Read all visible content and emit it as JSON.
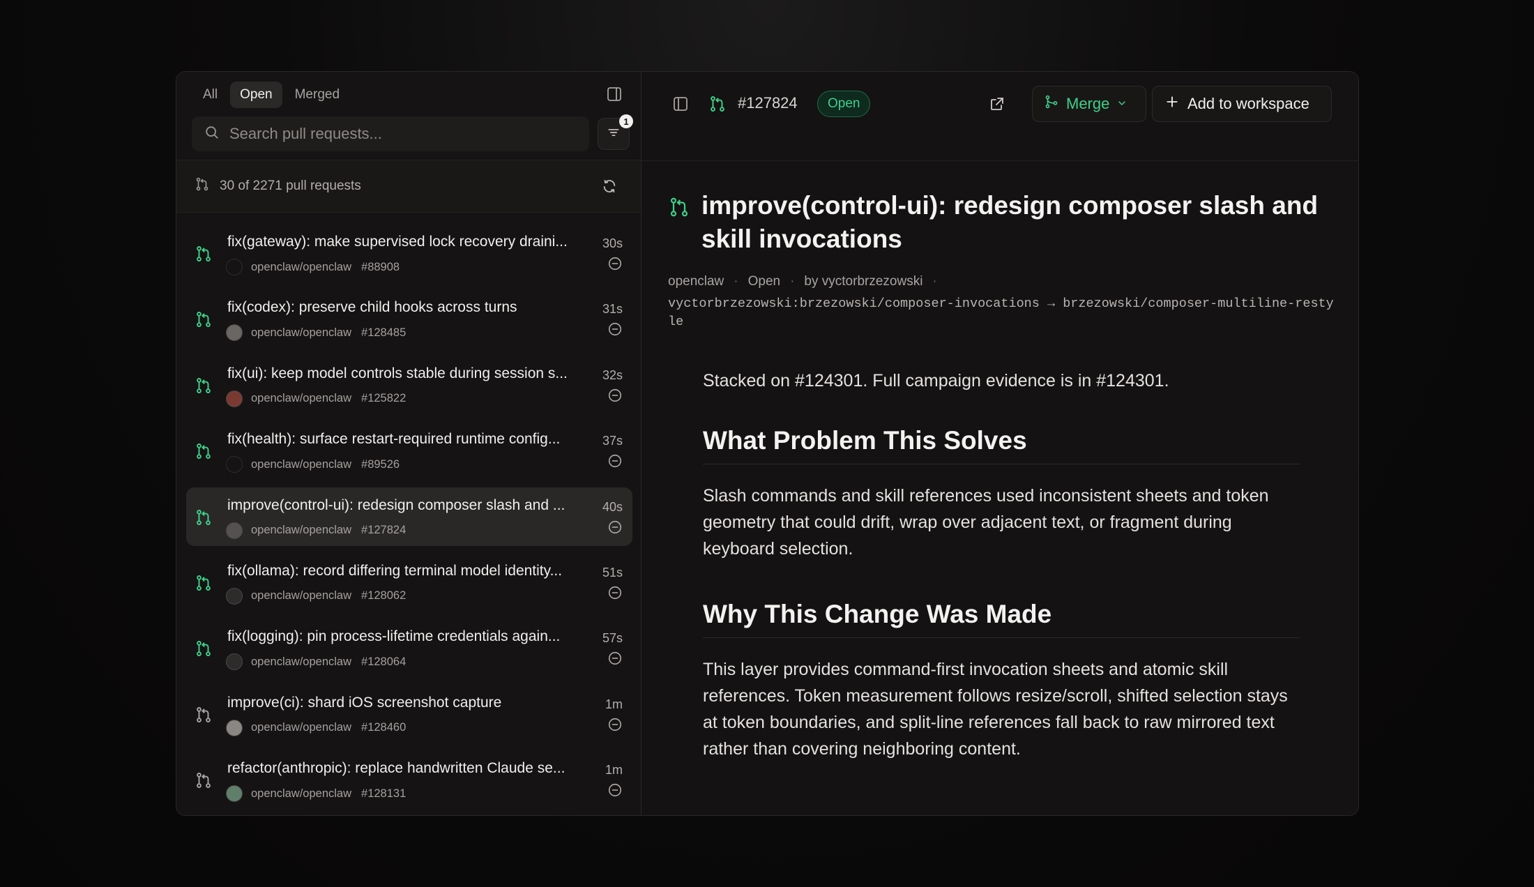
{
  "sidebar": {
    "tabs": [
      {
        "label": "All",
        "active": false
      },
      {
        "label": "Open",
        "active": true
      },
      {
        "label": "Merged",
        "active": false
      }
    ],
    "search": {
      "placeholder": "Search pull requests..."
    },
    "filter_badge": "1",
    "count_label": "30 of 2271 pull requests",
    "items": [
      {
        "title": "fix(gateway): make supervised lock recovery draini...",
        "repo": "openclaw/openclaw",
        "number": "#88908",
        "time": "30s"
      },
      {
        "title": "fix(codex): preserve child hooks across turns",
        "repo": "openclaw/openclaw",
        "number": "#128485",
        "time": "31s"
      },
      {
        "title": "fix(ui): keep model controls stable during session s...",
        "repo": "openclaw/openclaw",
        "number": "#125822",
        "time": "32s"
      },
      {
        "title": "fix(health): surface restart-required runtime config...",
        "repo": "openclaw/openclaw",
        "number": "#89526",
        "time": "37s"
      },
      {
        "title": "improve(control-ui): redesign composer slash and ...",
        "repo": "openclaw/openclaw",
        "number": "#127824",
        "time": "40s"
      },
      {
        "title": "fix(ollama): record differing terminal model identity...",
        "repo": "openclaw/openclaw",
        "number": "#128062",
        "time": "51s"
      },
      {
        "title": "fix(logging): pin process-lifetime credentials again...",
        "repo": "openclaw/openclaw",
        "number": "#128064",
        "time": "57s"
      },
      {
        "title": "improve(ci): shard iOS screenshot capture",
        "repo": "openclaw/openclaw",
        "number": "#128460",
        "time": "1m"
      },
      {
        "title": "refactor(anthropic): replace handwritten Claude se...",
        "repo": "openclaw/openclaw",
        "number": "#128131",
        "time": "1m"
      }
    ]
  },
  "detail": {
    "number": "#127824",
    "status": "Open",
    "merge_label": "Merge",
    "add_label": "Add to workspace",
    "title": "improve(control-ui): redesign composer slash and skill invocations",
    "meta": {
      "repo": "openclaw",
      "state": "Open",
      "author": "by vyctorbrzezowski"
    },
    "branch": "vyctorbrzezowski:brzezowski/composer-invocations → brzezowski/composer-multiline-restyle",
    "body": {
      "intro": "Stacked on #124301. Full campaign evidence is in #124301.",
      "h_problem": "What Problem This Solves",
      "p_problem": "Slash commands and skill references used inconsistent sheets and token geometry that could drift, wrap over adjacent text, or fragment during keyboard selection.",
      "h_why": "Why This Change Was Made",
      "p_why": "This layer provides command-first invocation sheets and atomic skill references. Token measurement follows resize/scroll, shifted selection stays at token boundaries, and split-line references fall back to raw mirrored text rather than covering neighboring content."
    }
  },
  "colors": {
    "accent": "#3ed08b",
    "background": "#141212",
    "selected_row": "#2a2827"
  }
}
